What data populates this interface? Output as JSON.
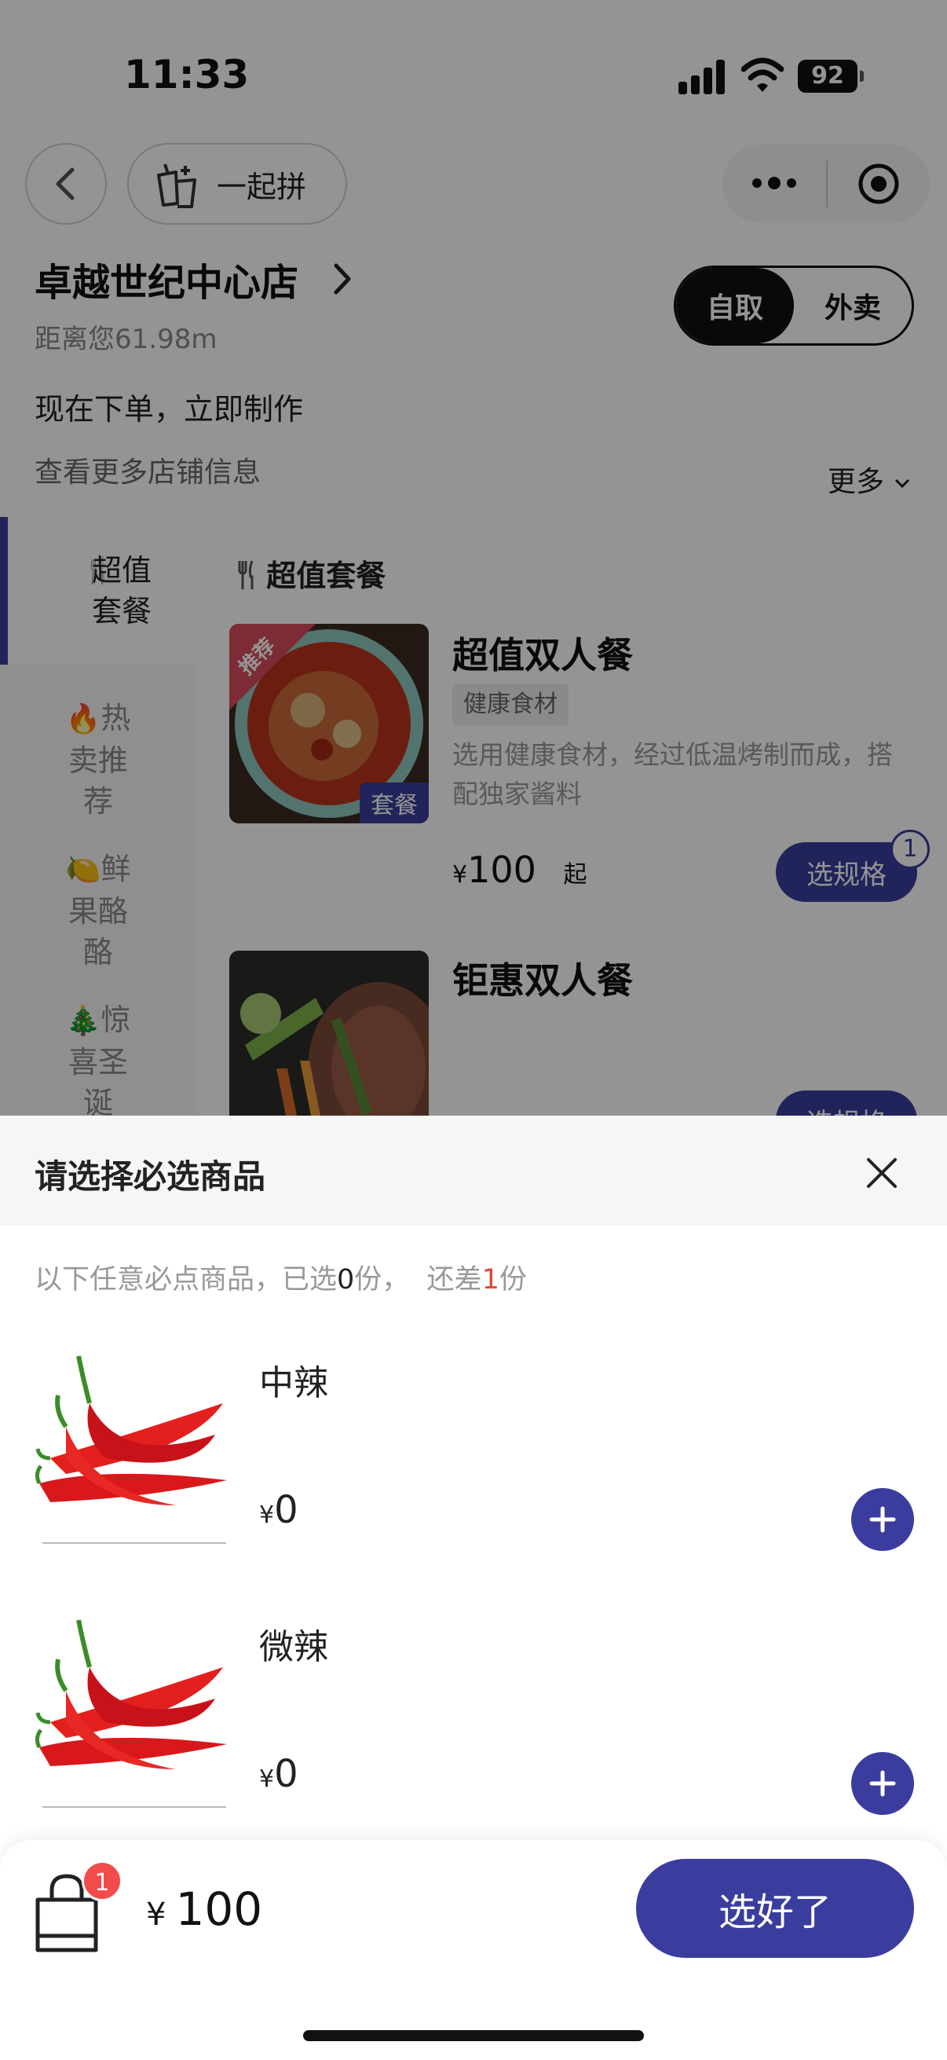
{
  "status_bar": {
    "time": "11:33",
    "battery": "92"
  },
  "nav": {
    "group_order_label": "一起拼"
  },
  "store": {
    "name": "卓越世纪中心店",
    "distance": "距离您61.98m",
    "notice": "现在下单，立即制作",
    "more_info": "查看更多店铺信息",
    "more": "更多",
    "modes": [
      "自取",
      "外卖"
    ],
    "active_mode": "自取"
  },
  "categories": [
    {
      "icon": "🍴",
      "label": "超值套餐",
      "active": true
    },
    {
      "icon": "🔥",
      "label": "热卖推荐",
      "active": false
    },
    {
      "icon": "🍋",
      "label": "鲜果酪酪",
      "active": false
    },
    {
      "icon": "🎄",
      "label": "惊喜圣诞",
      "active": false
    }
  ],
  "section_title": "超值套餐",
  "products": [
    {
      "name": "超值双人餐",
      "tag": "健康食材",
      "description": "选用健康食材，经过低温烤制而成，搭配独家酱料",
      "price": "100",
      "price_suffix": "起",
      "corner_tag": "推荐",
      "image_tag": "套餐",
      "button": "选规格",
      "selected_count": "1"
    },
    {
      "name": "钜惠双人餐",
      "button": "选规格"
    }
  ],
  "currency": "¥",
  "sheet": {
    "title": "请选择必选商品",
    "hint_prefix": "以下任意必点商品，已选",
    "selected": "0",
    "hint_mid": "份，  还差",
    "remaining": "1",
    "hint_suffix": "份",
    "items": [
      {
        "name": "中辣",
        "price": "0"
      },
      {
        "name": "微辣",
        "price": "0"
      }
    ]
  },
  "cart": {
    "count": "1",
    "total": "100",
    "confirm_label": "选好了"
  },
  "colors": {
    "accent": "#3a3d9e",
    "badge_red": "#f24b4b",
    "highlight_red": "#e04a3a"
  }
}
